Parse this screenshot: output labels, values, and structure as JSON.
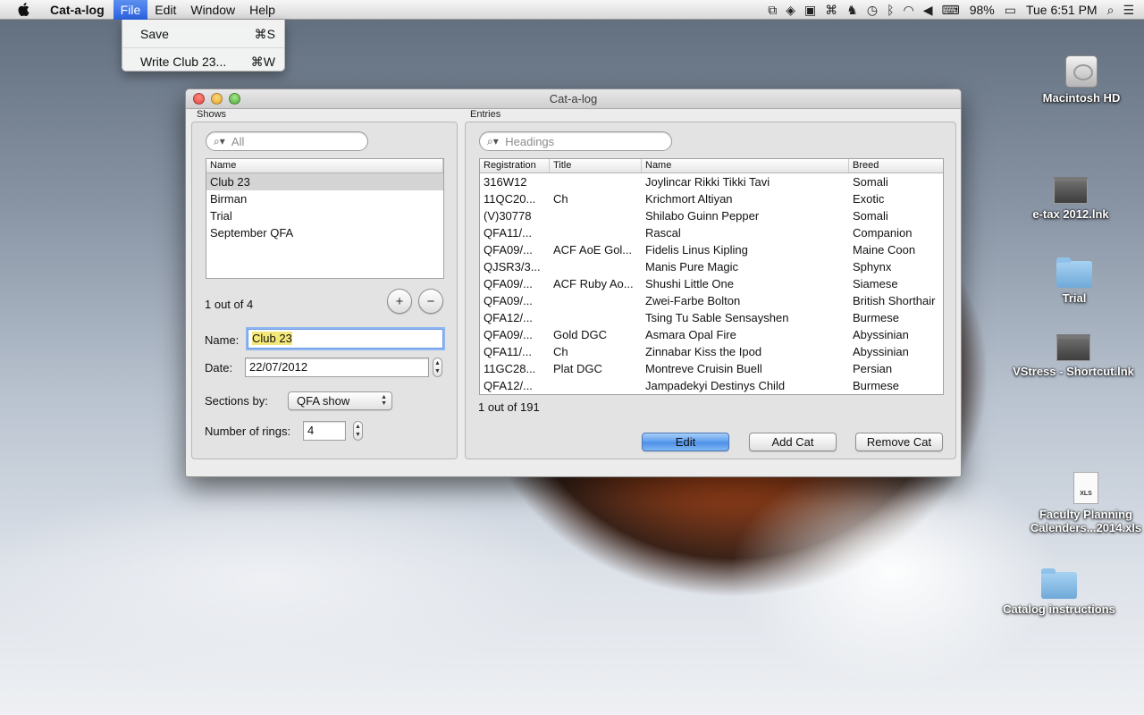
{
  "menubar": {
    "app_name": "Cat-a-log",
    "menus": [
      "File",
      "Edit",
      "Window",
      "Help"
    ],
    "battery": "98%",
    "clock": "Tue 6:51 PM"
  },
  "file_menu": {
    "items": [
      {
        "label": "Save",
        "shortcut": "⌘S"
      },
      {
        "label": "Write Club 23...",
        "shortcut": "⌘W"
      }
    ]
  },
  "desktop_icons": [
    {
      "label": "Macintosh HD",
      "icon": "hard-drive-icon"
    },
    {
      "label": "e-tax 2012.lnk",
      "icon": "shortcut-icon"
    },
    {
      "label": "Trial",
      "icon": "folder-icon"
    },
    {
      "label": "VStress - Shortcut.lnk",
      "icon": "shortcut-icon"
    },
    {
      "label": "Faculty Planning",
      "label2": "Calenders...2014.xls",
      "icon": "xls-file-icon"
    },
    {
      "label": "Catalog instructions",
      "icon": "folder-icon"
    }
  ],
  "window": {
    "title": "Cat-a-log",
    "shows": {
      "group_label": "Shows",
      "search_placeholder": "All",
      "column_header": "Name",
      "items": [
        "Club 23",
        "Birman",
        "Trial",
        "September QFA"
      ],
      "selected_index": 0,
      "count_text": "1 out of 4",
      "add_label": "+",
      "remove_label": "−",
      "name_label": "Name:",
      "name_value": "Club 23",
      "date_label": "Date:",
      "date_value": "22/07/2012",
      "sections_label": "Sections by:",
      "sections_value": "QFA show",
      "rings_label": "Number of rings:",
      "rings_value": "4"
    },
    "entries": {
      "group_label": "Entries",
      "search_placeholder": "Headings",
      "columns": [
        "Registration",
        "Title",
        "Name",
        "Breed"
      ],
      "rows": [
        [
          "316W12",
          "",
          "Joylincar Rikki Tikki Tavi",
          "Somali"
        ],
        [
          "11QC20...",
          "Ch",
          "Krichmort Altiyan",
          "Exotic"
        ],
        [
          "(V)30778",
          "",
          "Shilabo Guinn Pepper",
          "Somali"
        ],
        [
          "QFA11/...",
          "",
          "Rascal",
          "Companion"
        ],
        [
          "QFA09/...",
          "ACF AoE Gol...",
          "Fidelis Linus Kipling",
          "Maine Coon"
        ],
        [
          "QJSR3/3...",
          "",
          "Manis Pure Magic",
          "Sphynx"
        ],
        [
          "QFA09/...",
          "ACF Ruby Ao...",
          "Shushi Little One",
          "Siamese"
        ],
        [
          "QFA09/...",
          "",
          "Zwei-Farbe Bolton",
          "British Shorthair"
        ],
        [
          "QFA12/...",
          "",
          "Tsing Tu Sable Sensayshen",
          "Burmese"
        ],
        [
          "QFA09/...",
          "Gold DGC",
          "Asmara Opal Fire",
          "Abyssinian"
        ],
        [
          "QFA11/...",
          "Ch",
          "Zinnabar Kiss the Ipod",
          "Abyssinian"
        ],
        [
          "11GC28...",
          "Plat DGC",
          "Montreve Cruisin Buell",
          "Persian"
        ],
        [
          "QFA12/...",
          "",
          "Jampadekyi Destinys Child",
          "Burmese"
        ]
      ],
      "count_text": "1 out of 191",
      "edit_label": "Edit",
      "add_cat_label": "Add Cat",
      "remove_cat_label": "Remove Cat"
    }
  },
  "colors": {
    "menu_highlight": "#2a62e0",
    "selection_gray": "#d4d4d4",
    "default_button": "#5c9ef0",
    "text_highlight": "#f5e87a"
  }
}
